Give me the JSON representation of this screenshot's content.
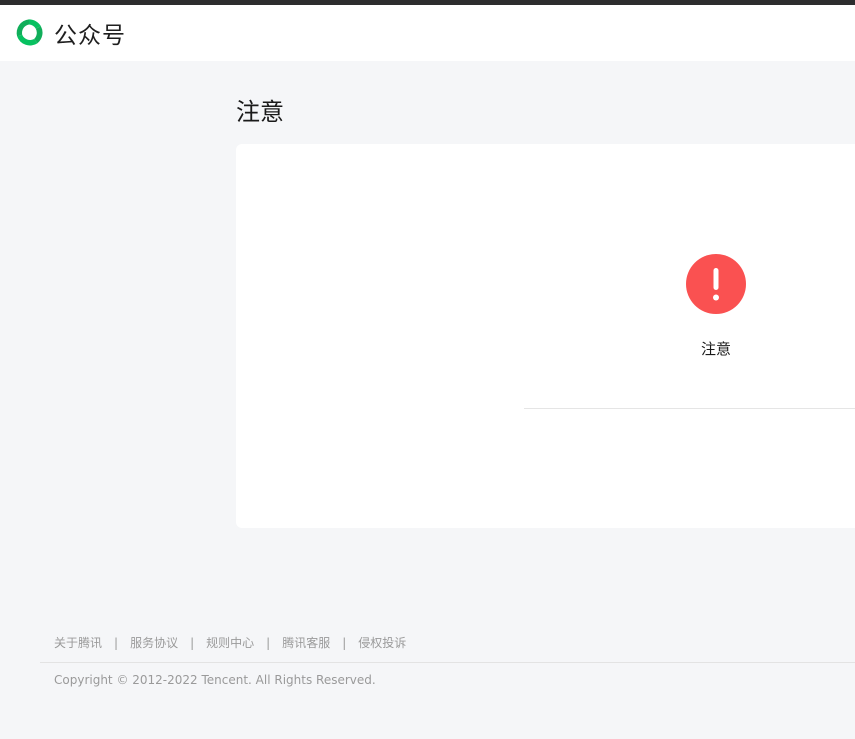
{
  "header": {
    "logo_text": "公众号"
  },
  "page": {
    "title": "注意"
  },
  "card": {
    "message": "注意",
    "icon": "exclamation-icon",
    "icon_color": "#fa5151"
  },
  "footer": {
    "links": [
      "关于腾讯",
      "服务协议",
      "规则中心",
      "腾讯客服",
      "侵权投诉"
    ],
    "separator": "|",
    "copyright": "Copyright © 2012-2022 Tencent. All Rights Reserved."
  },
  "colors": {
    "brand_green": "#07c160",
    "background": "#f5f6f8"
  }
}
